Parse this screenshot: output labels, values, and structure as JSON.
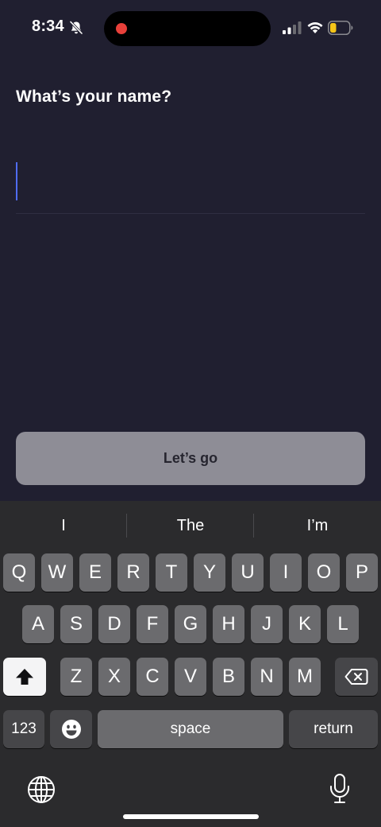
{
  "status_bar": {
    "time": "8:34",
    "icons": [
      "bell-slash-icon",
      "recording-dot-icon",
      "cellular-signal-icon",
      "wifi-icon",
      "battery-low-icon"
    ],
    "recording_color": "#e8403a",
    "battery_color": "#f5c518"
  },
  "screen": {
    "title": "What’s your name?",
    "name_input": {
      "value": "",
      "placeholder": ""
    },
    "caret_color": "#4f6cf0",
    "cta_label": "Let’s go"
  },
  "keyboard": {
    "suggestions": [
      "I",
      "The",
      "I’m"
    ],
    "rows": [
      [
        "Q",
        "W",
        "E",
        "R",
        "T",
        "Y",
        "U",
        "I",
        "O",
        "P"
      ],
      [
        "A",
        "S",
        "D",
        "F",
        "G",
        "H",
        "J",
        "K",
        "L"
      ],
      [
        "Z",
        "X",
        "C",
        "V",
        "B",
        "N",
        "M"
      ]
    ],
    "numbers_label": "123",
    "space_label": "space",
    "return_label": "return",
    "icons": [
      "shift-icon",
      "backspace-icon",
      "emoji-icon",
      "globe-icon",
      "microphone-icon"
    ]
  }
}
